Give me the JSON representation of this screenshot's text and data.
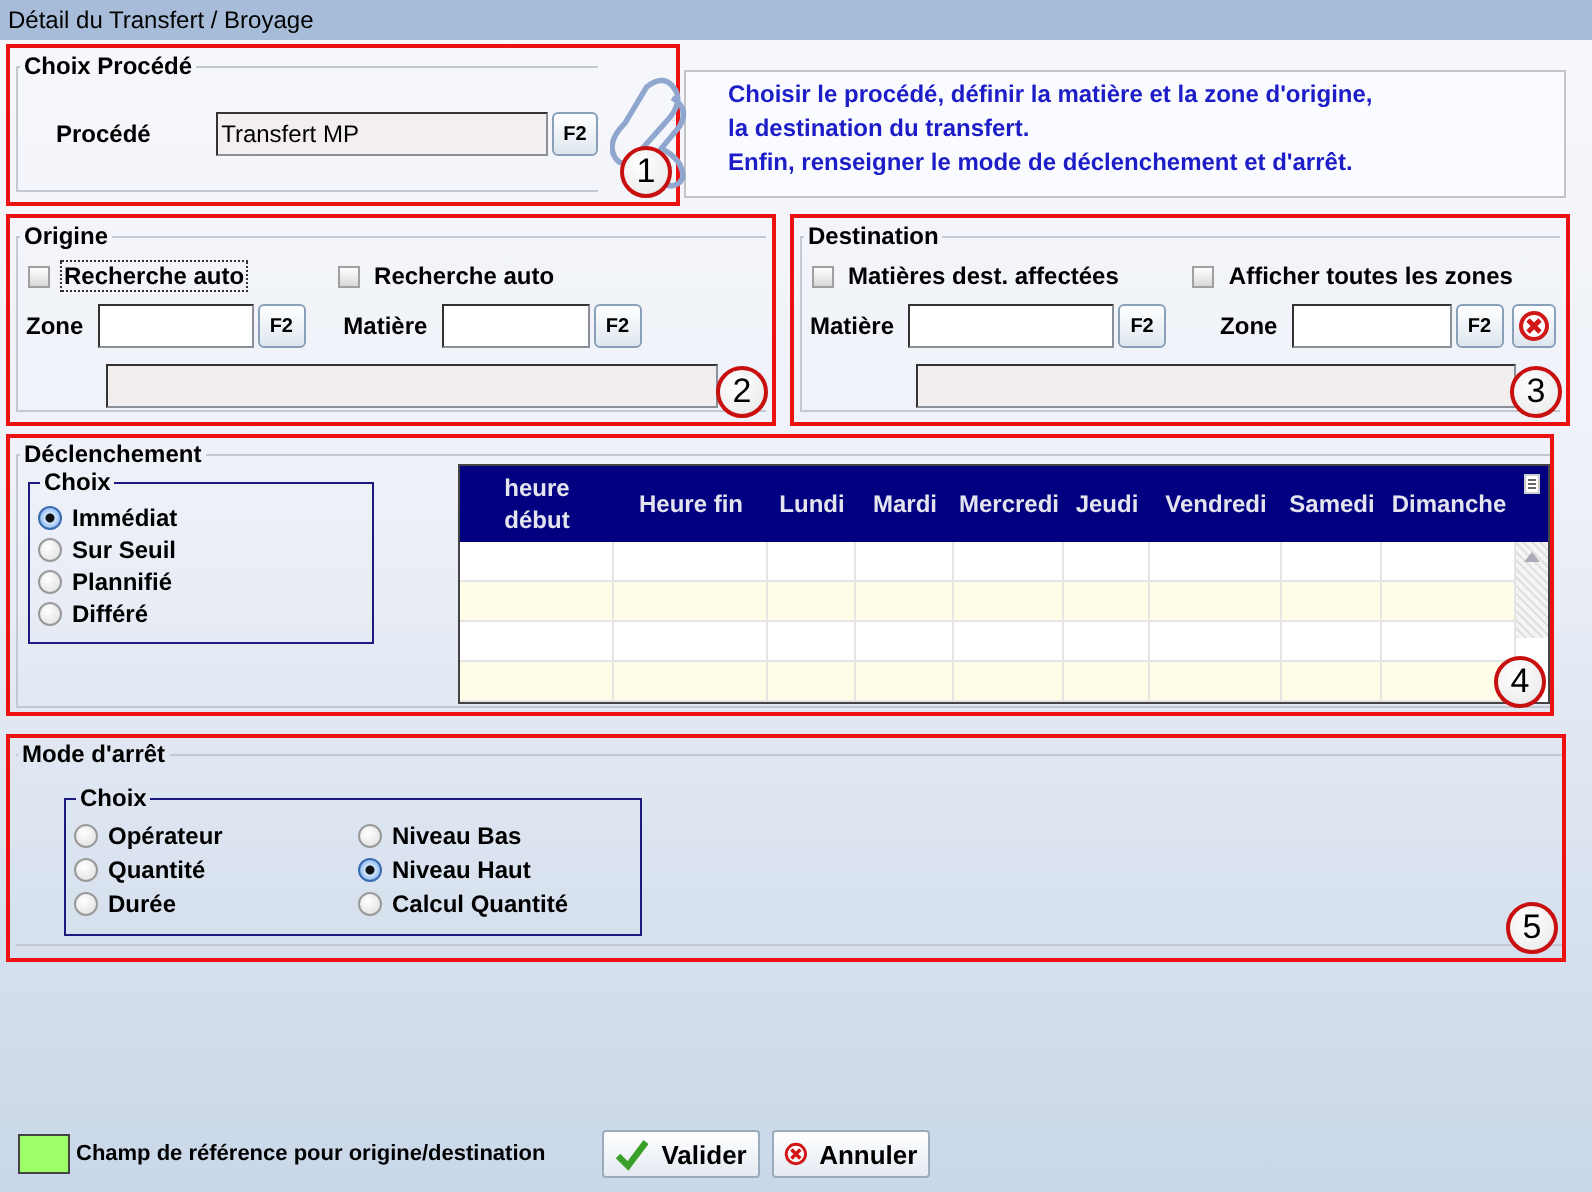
{
  "window": {
    "title": "Détail du Transfert / Broyage"
  },
  "procede": {
    "title": "Choix Procédé",
    "label": "Procédé",
    "value": "Transfert MP",
    "button": "F2",
    "callout": "1"
  },
  "info": {
    "lines": [
      "Choisir le procédé, définir la matière et la zone d'origine,",
      "la destination du transfert.",
      "Enfin, renseigner le mode de déclenchement et d'arrêt."
    ]
  },
  "origine": {
    "title": "Origine",
    "checks": [
      {
        "label": "Recherche auto",
        "checked": false,
        "focused": true
      },
      {
        "label": "Recherche auto",
        "checked": false,
        "focused": false
      }
    ],
    "fields": [
      {
        "label": "Zone",
        "button": "F2"
      },
      {
        "label": "Matière",
        "button": "F2"
      }
    ],
    "callout": "2"
  },
  "destination": {
    "title": "Destination",
    "checks": [
      {
        "label": "Matières dest. affectées",
        "checked": false,
        "focused": false
      },
      {
        "label": "Afficher toutes les zones",
        "checked": false,
        "focused": false
      }
    ],
    "fields": [
      {
        "label": "Matière",
        "button": "F2"
      },
      {
        "label": "Zone",
        "button": "F2"
      }
    ],
    "callout": "3"
  },
  "declenchement": {
    "title": "Déclenchement",
    "choice_title": "Choix",
    "options": [
      {
        "label": "Immédiat",
        "selected": true
      },
      {
        "label": "Sur Seuil",
        "selected": false
      },
      {
        "label": "Plannifié",
        "selected": false
      },
      {
        "label": "Différé",
        "selected": false
      }
    ],
    "table": {
      "columns": [
        "heure début",
        "Heure fin",
        "Lundi",
        "Mardi",
        "Mercredi",
        "Jeudi",
        "Vendredi",
        "Samedi",
        "Dimanche"
      ]
    },
    "callout": "4"
  },
  "mode_arret": {
    "title": "Mode d'arrêt",
    "choice_title": "Choix",
    "options": [
      {
        "label": "Opérateur",
        "selected": false
      },
      {
        "label": "Niveau Bas",
        "selected": false
      },
      {
        "label": "Quantité",
        "selected": false
      },
      {
        "label": "Niveau Haut",
        "selected": true
      },
      {
        "label": "Durée",
        "selected": false
      },
      {
        "label": "Calcul Quantité",
        "selected": false
      }
    ],
    "callout": "5"
  },
  "legend": {
    "label": "Champ de référence pour origine/destination"
  },
  "buttons": [
    {
      "label": "Valider",
      "kind": "ok"
    },
    {
      "label": "Annuler",
      "kind": "cancel"
    }
  ]
}
